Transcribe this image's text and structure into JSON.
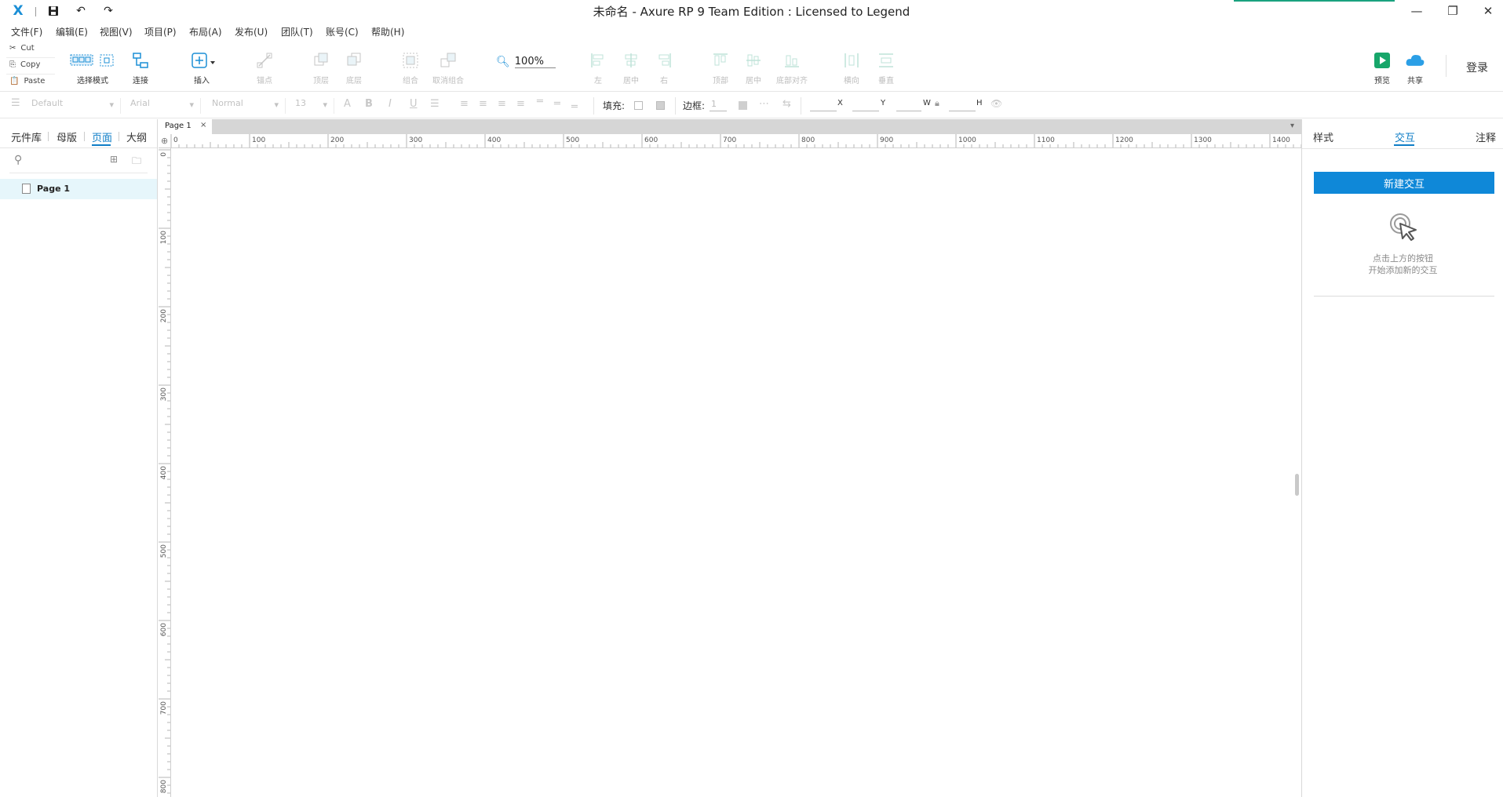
{
  "window": {
    "title": "未命名 - Axure RP 9 Team Edition : Licensed to Legend",
    "logo": "X"
  },
  "menu": [
    "文件(F)",
    "编辑(E)",
    "视图(V)",
    "项目(P)",
    "布局(A)",
    "发布(U)",
    "团队(T)",
    "账号(C)",
    "帮助(H)"
  ],
  "clipboard": {
    "cut": "Cut",
    "copy": "Copy",
    "paste": "Paste"
  },
  "toolbar": {
    "select_mode": "选择模式",
    "connect": "连接",
    "insert": "插入",
    "point": "锚点",
    "top_layer": "顶层",
    "bottom_layer": "底层",
    "group": "组合",
    "ungroup": "取消组合",
    "zoom": "100%",
    "align_left": "左",
    "align_center": "居中",
    "align_right": "右",
    "align_top": "顶部",
    "align_middle": "居中",
    "align_bottom": "底部对齐",
    "dist_h": "横向",
    "dist_v": "垂直",
    "preview": "预览",
    "share": "共享",
    "login": "登录"
  },
  "format": {
    "style": "Default",
    "font": "Arial",
    "weight": "Normal",
    "size": "13",
    "fill_label": "填充:",
    "border_label": "边框:",
    "border_value": "1",
    "x": "X",
    "y": "Y",
    "w": "W",
    "h": "H"
  },
  "left_panel": {
    "tabs": [
      "元件库",
      "母版",
      "页面",
      "大纲"
    ],
    "active_tab": "页面",
    "page_name": "Page 1"
  },
  "canvas": {
    "tab": "Page 1",
    "ruler_top": [
      "0",
      "100",
      "200",
      "300",
      "400",
      "500",
      "600",
      "700",
      "800",
      "900",
      "1000",
      "1100",
      "1200",
      "1300",
      "1400"
    ],
    "ruler_left": [
      "0",
      "100",
      "200",
      "300",
      "400",
      "500",
      "600",
      "700",
      "800"
    ]
  },
  "right_panel": {
    "tabs": [
      "样式",
      "交互",
      "注释"
    ],
    "active_tab": "交互",
    "new_interaction": "新建交互",
    "hint_line1": "点击上方的按钮",
    "hint_line2": "开始添加新的交互"
  },
  "colors": {
    "accent": "#0f88d8",
    "active_tab": "#0f7ec7",
    "preview_green": "#17a66a",
    "share_blue": "#2b9fe6",
    "selected_row": "#e6f6fb"
  }
}
